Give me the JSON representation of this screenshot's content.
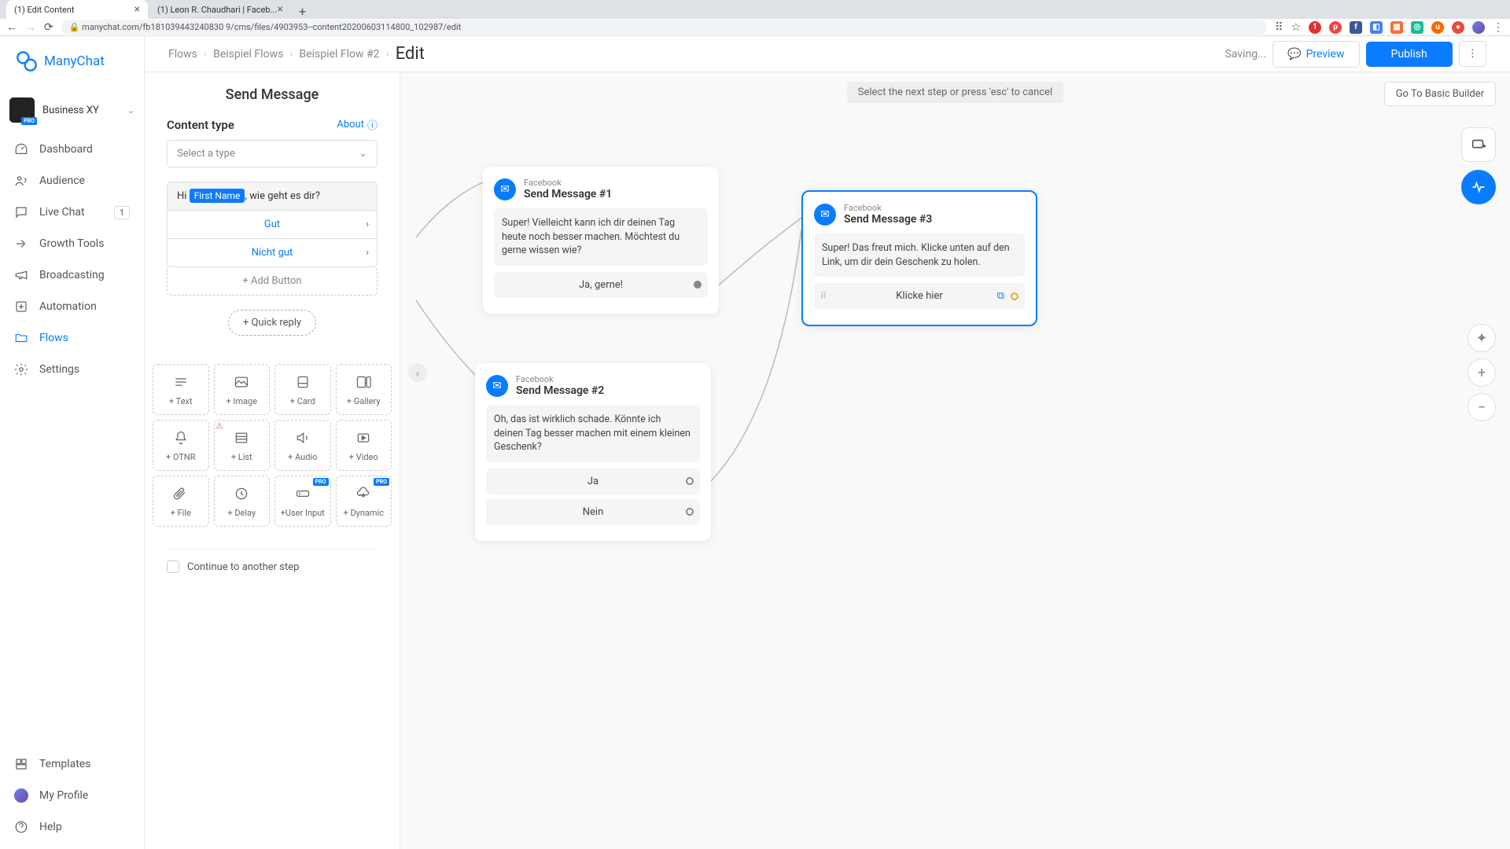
{
  "browser": {
    "tabs": [
      {
        "title": "(1) Edit Content"
      },
      {
        "title": "(1) Leon R. Chaudhari | Faceb..."
      }
    ],
    "url": "manychat.com/fb181039443240830 9/cms/files/4903953--content20200603114800_102987/edit"
  },
  "brand": "ManyChat",
  "account": {
    "name": "Business XY",
    "badge": "PRO"
  },
  "nav": {
    "dashboard": "Dashboard",
    "audience": "Audience",
    "livechat": "Live Chat",
    "livechat_badge": "1",
    "growth": "Growth Tools",
    "broadcasting": "Broadcasting",
    "automation": "Automation",
    "flows": "Flows",
    "settings": "Settings",
    "templates": "Templates",
    "profile": "My Profile",
    "help": "Help"
  },
  "topbar": {
    "crumbs": [
      "Flows",
      "Beispiel Flows",
      "Beispiel Flow #2"
    ],
    "current": "Edit",
    "saving": "Saving...",
    "preview": "Preview",
    "publish": "Publish",
    "basic": "Go To Basic Builder"
  },
  "panel": {
    "title": "Send Message",
    "content_type": "Content type",
    "about": "About",
    "select_placeholder": "Select a type",
    "msg_pre": "Hi ",
    "msg_var": "First Name",
    "msg_post": ", wie geht es dir?",
    "opt1": "Gut",
    "opt2": "Nicht gut",
    "add_button": "+ Add Button",
    "quick_reply": "+ Quick reply",
    "blocks": {
      "text": "+ Text",
      "image": "+ Image",
      "card": "+ Card",
      "gallery": "+ Gallery",
      "otnr": "+ OTNR",
      "list": "+ List",
      "audio": "+ Audio",
      "video": "+ Video",
      "file": "+ File",
      "delay": "+ Delay",
      "userinput": "+User Input",
      "dynamic": "+ Dynamic"
    },
    "continue": "Continue to another step"
  },
  "canvas": {
    "hint": "Select the next step or press 'esc' to cancel",
    "node1": {
      "sub": "Facebook",
      "title": "Send Message #1",
      "msg": "Super! Vielleicht kann ich dir deinen Tag heute noch besser machen. Möchtest du gerne wissen wie?",
      "btn": "Ja, gerne!"
    },
    "node2": {
      "sub": "Facebook",
      "title": "Send Message #2",
      "msg": "Oh, das ist wirklich schade. Könnte ich deinen Tag besser machen mit einem kleinen Geschenk?",
      "btn1": "Ja",
      "btn2": "Nein"
    },
    "node3": {
      "sub": "Facebook",
      "title": "Send Message #3",
      "msg": "Super! Das freut mich. Klicke unten auf den Link, um dir dein Geschenk zu holen.",
      "btn": "Klicke hier"
    }
  }
}
